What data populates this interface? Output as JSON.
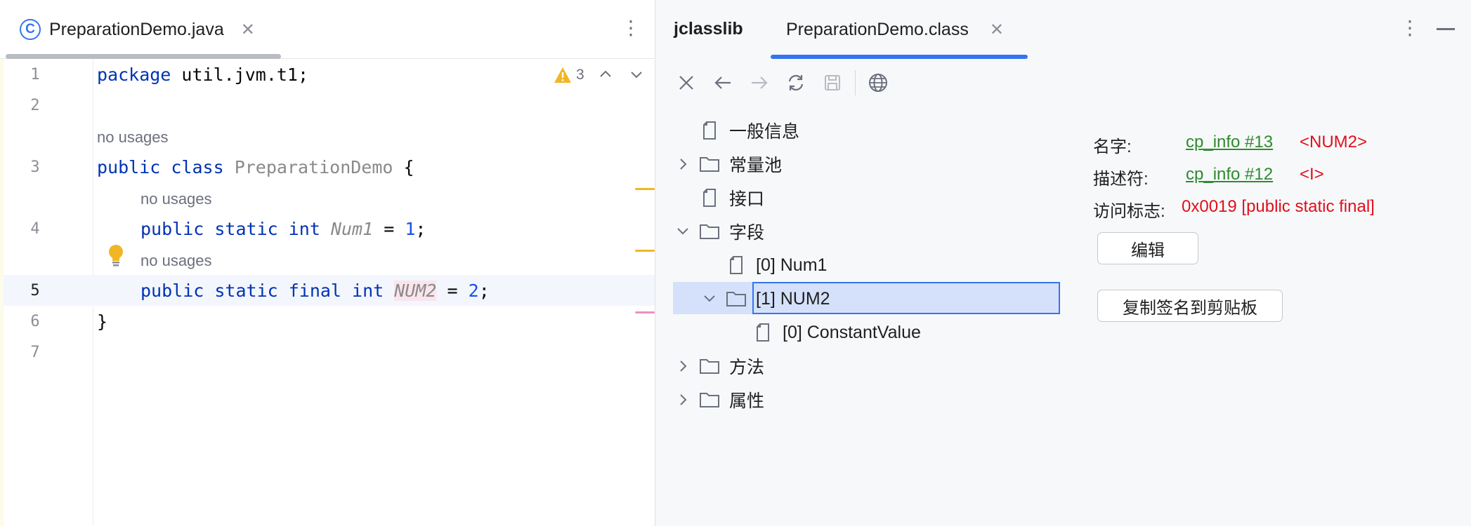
{
  "editor": {
    "tab_label": "PreparationDemo.java",
    "tab_icon": "C",
    "warning_count": "3",
    "line_numbers": [
      "1",
      "2",
      "3",
      "4",
      "5",
      "6",
      "7"
    ],
    "hints": {
      "class_usages": "no usages",
      "num1_usages": "no usages",
      "num2_usages": "no usages"
    },
    "code": {
      "line1_kw": "package",
      "line1_rest": " util.jvm.t1;",
      "line3_kw": "public class",
      "line3_name": "PreparationDemo",
      "line3_rest": " {",
      "line4_kw": "public static int",
      "line4_name": "Num1",
      "line4_eq": " = ",
      "line4_val": "1",
      "line4_end": ";",
      "line5_kw": "public static final int",
      "line5_name": "NUM2",
      "line5_eq": " = ",
      "line5_val": "2",
      "line5_end": ";",
      "line6": "}"
    }
  },
  "jclasslib": {
    "title": "jclasslib",
    "file_tab": "PreparationDemo.class",
    "tree": [
      {
        "label": "一般信息",
        "indent": 0
      },
      {
        "label": "常量池",
        "indent": 0
      },
      {
        "label": "接口",
        "indent": 0
      },
      {
        "label": "字段",
        "indent": 0
      },
      {
        "label": "[0] Num1",
        "indent": 1
      },
      {
        "label": "[1] NUM2",
        "indent": 1
      },
      {
        "label": "[0] ConstantValue",
        "indent": 2
      },
      {
        "label": "方法",
        "indent": 0
      },
      {
        "label": "属性",
        "indent": 0
      }
    ],
    "details": {
      "name_label": "名字:",
      "name_link": "cp_info #13",
      "name_value": "<NUM2>",
      "descriptor_label": "描述符:",
      "descriptor_link": "cp_info #12",
      "descriptor_value": "<I>",
      "access_label": "访问标志:",
      "access_value": "0x0019 [public static final]",
      "edit_button": "编辑",
      "copy_button": "复制签名到剪贴板"
    }
  },
  "colors": {
    "accent": "#3574f0",
    "keyword": "#0033b3",
    "link": "#2e8b2e",
    "error_red": "#e0101c"
  }
}
